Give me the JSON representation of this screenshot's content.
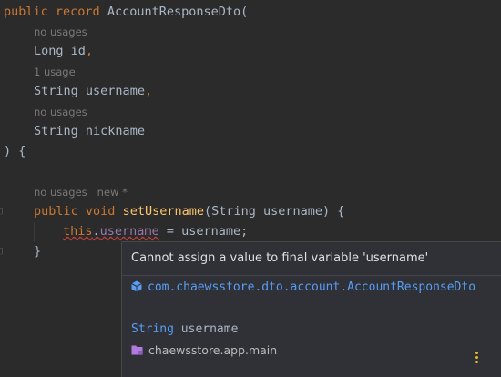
{
  "code": {
    "line1": {
      "kw1": "public",
      "kw2": "record",
      "name": "AccountResponseDto("
    },
    "hint1": "no usages",
    "line2": {
      "type": "Long",
      "name": "id",
      "comma": ","
    },
    "hint2": "1 usage",
    "line3": {
      "type": "String",
      "name": "username",
      "comma": ","
    },
    "hint3": "no usages",
    "line4": {
      "type": "String",
      "name": "nickname"
    },
    "line5": ") {",
    "hint4": {
      "usages": "no usages",
      "status": "new *"
    },
    "line6": {
      "kw1": "public",
      "kw2": "void",
      "method": "setUsername",
      "params": "(String username) {"
    },
    "line7": {
      "this": "this",
      "dot": ".",
      "field": "username",
      "rest": " = username;"
    },
    "line8": "}"
  },
  "popup": {
    "message": "Cannot assign a value to final variable 'username'",
    "class_fqn": "com.chaewsstore.dto.account.AccountResponseDto",
    "decl_type": "String",
    "decl_name": "username",
    "module": "chaewsstore.app.main",
    "class_icon": "class-icon",
    "module_icon": "folder-icon",
    "more_icon": "more-vertical-icon",
    "more_color": "#e5b92b",
    "link_color": "#589df6"
  }
}
